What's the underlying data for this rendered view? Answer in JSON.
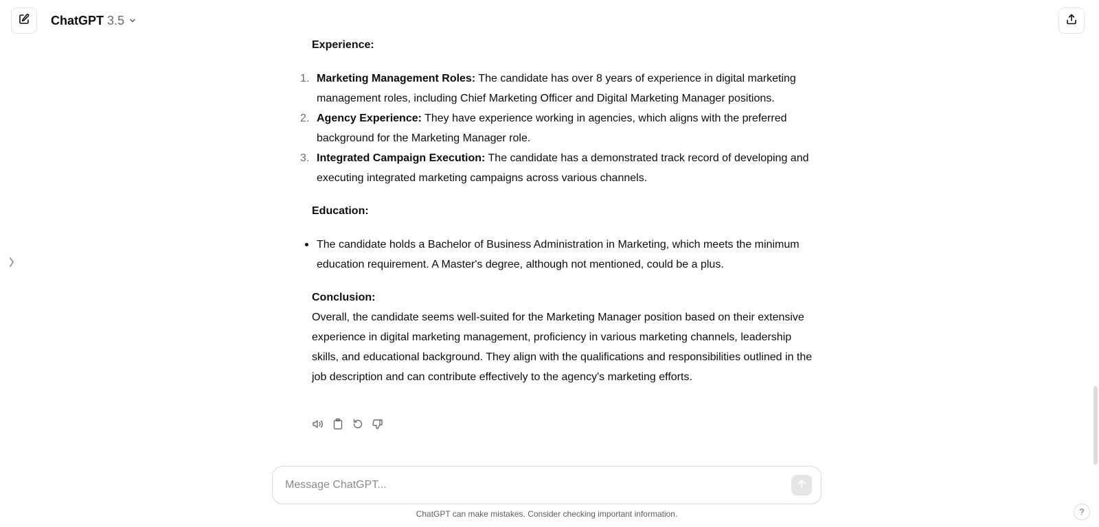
{
  "header": {
    "model_name": "ChatGPT",
    "model_version": "3.5",
    "icons": {
      "new_chat": "compose-icon",
      "model_menu": "chevron-down-icon",
      "share": "share-icon",
      "sidebar": "sidebar-toggle-icon"
    }
  },
  "message": {
    "experience": {
      "heading": "Experience:",
      "items": [
        {
          "number": "1.",
          "title": "Marketing Management Roles:",
          "text": " The candidate has over 8 years of experience in digital marketing management roles, including Chief Marketing Officer and Digital Marketing Manager positions."
        },
        {
          "number": "2.",
          "title": "Agency Experience:",
          "text": " They have experience working in agencies, which aligns with the preferred background for the Marketing Manager role."
        },
        {
          "number": "3.",
          "title": "Integrated Campaign Execution:",
          "text": " The candidate has a demonstrated track record of developing and executing integrated marketing campaigns across various channels."
        }
      ]
    },
    "education": {
      "heading": "Education:",
      "items": [
        {
          "text": "The candidate holds a Bachelor of Business Administration in Marketing, which meets the minimum education requirement. A Master's degree, although not mentioned, could be a plus."
        }
      ]
    },
    "conclusion": {
      "heading": "Conclusion:",
      "text": "Overall, the candidate seems well-suited for the Marketing Manager position based on their extensive experience in digital marketing management, proficiency in various marketing channels, leadership skills, and educational background. They align with the qualifications and responsibilities outlined in the job description and can contribute effectively to the agency's marketing efforts."
    },
    "actions": [
      "read-aloud-icon",
      "copy-icon",
      "regenerate-icon",
      "thumbs-down-icon"
    ]
  },
  "composer": {
    "placeholder": "Message ChatGPT...",
    "send_icon": "arrow-up-icon"
  },
  "footer": {
    "disclaimer": "ChatGPT can make mistakes. Consider checking important information.",
    "help_label": "?"
  }
}
